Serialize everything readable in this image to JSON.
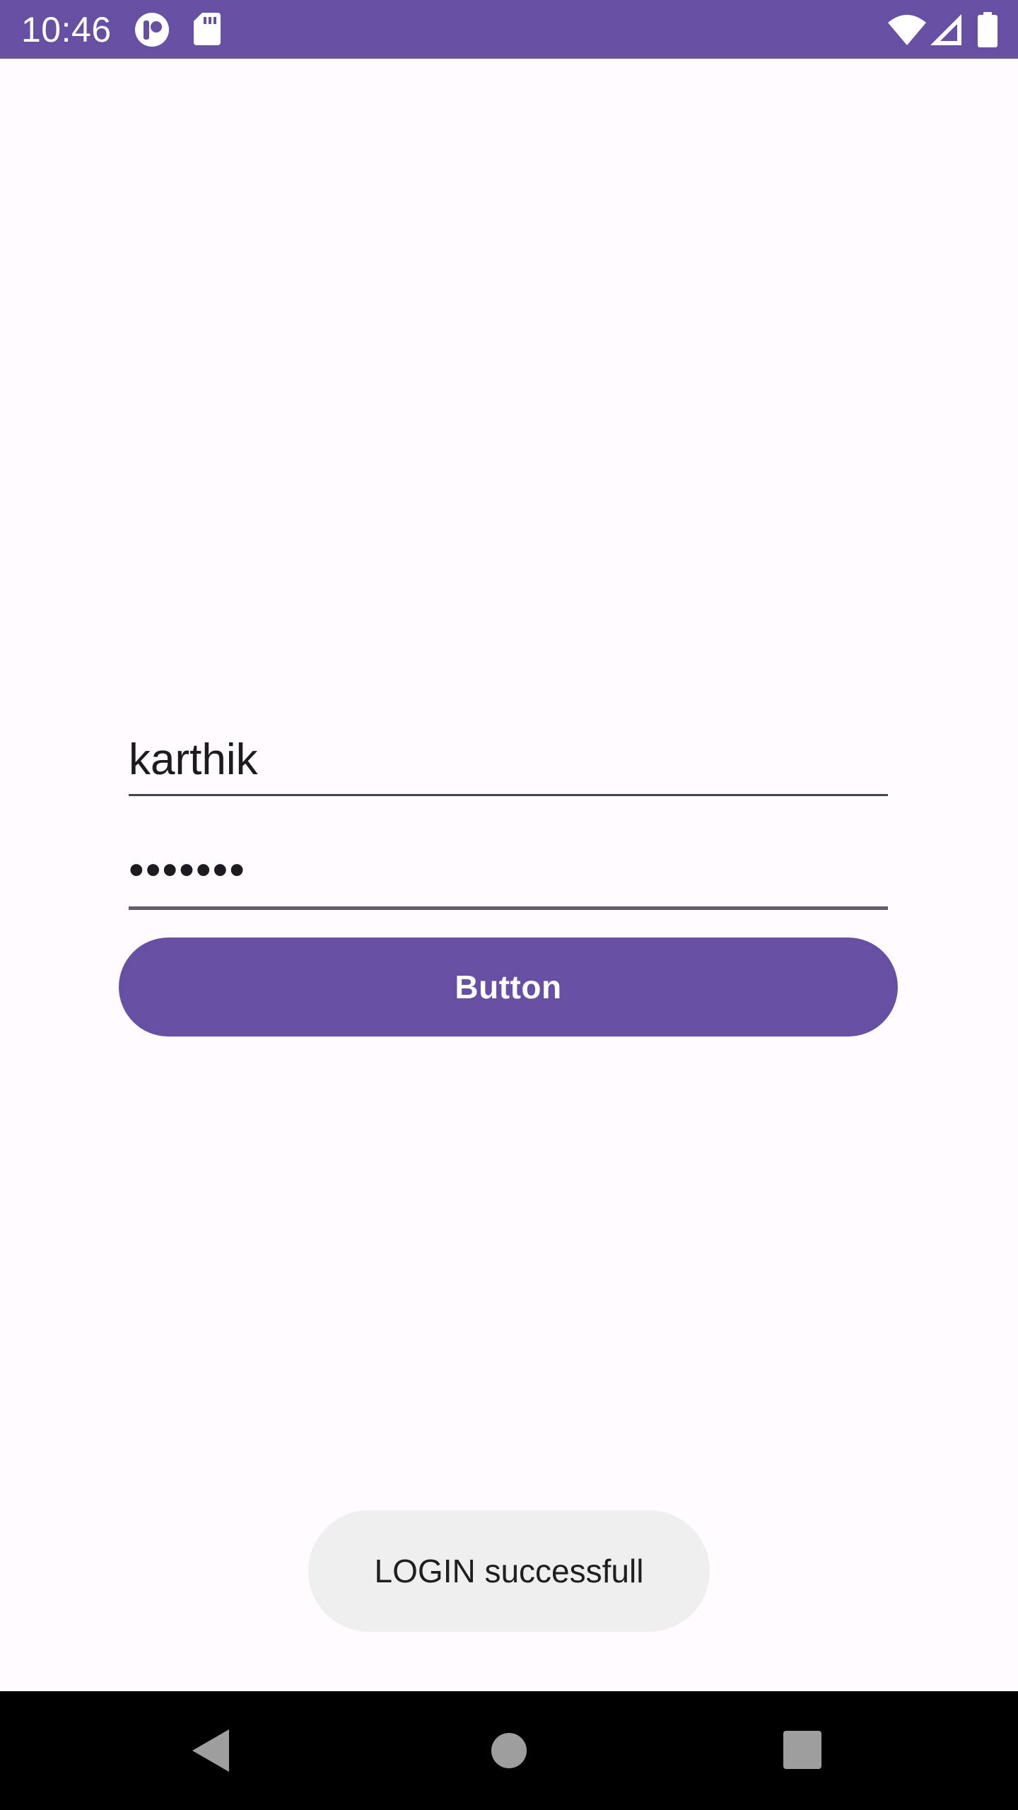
{
  "status_bar": {
    "time": "10:46",
    "background_color": "#6750a4",
    "icons_left": [
      "app-notification-icon",
      "sd-card-icon"
    ],
    "icons_right": [
      "wifi-icon",
      "cell-signal-icon",
      "battery-icon"
    ]
  },
  "login_form": {
    "username_value": "karthik",
    "password_value": "•••••••",
    "button_label": "Button",
    "accent_color": "#6750a4"
  },
  "toast": {
    "message": "LOGIN successfull"
  },
  "nav_bar": {
    "icons": [
      "back-icon",
      "home-icon",
      "recents-icon"
    ]
  }
}
